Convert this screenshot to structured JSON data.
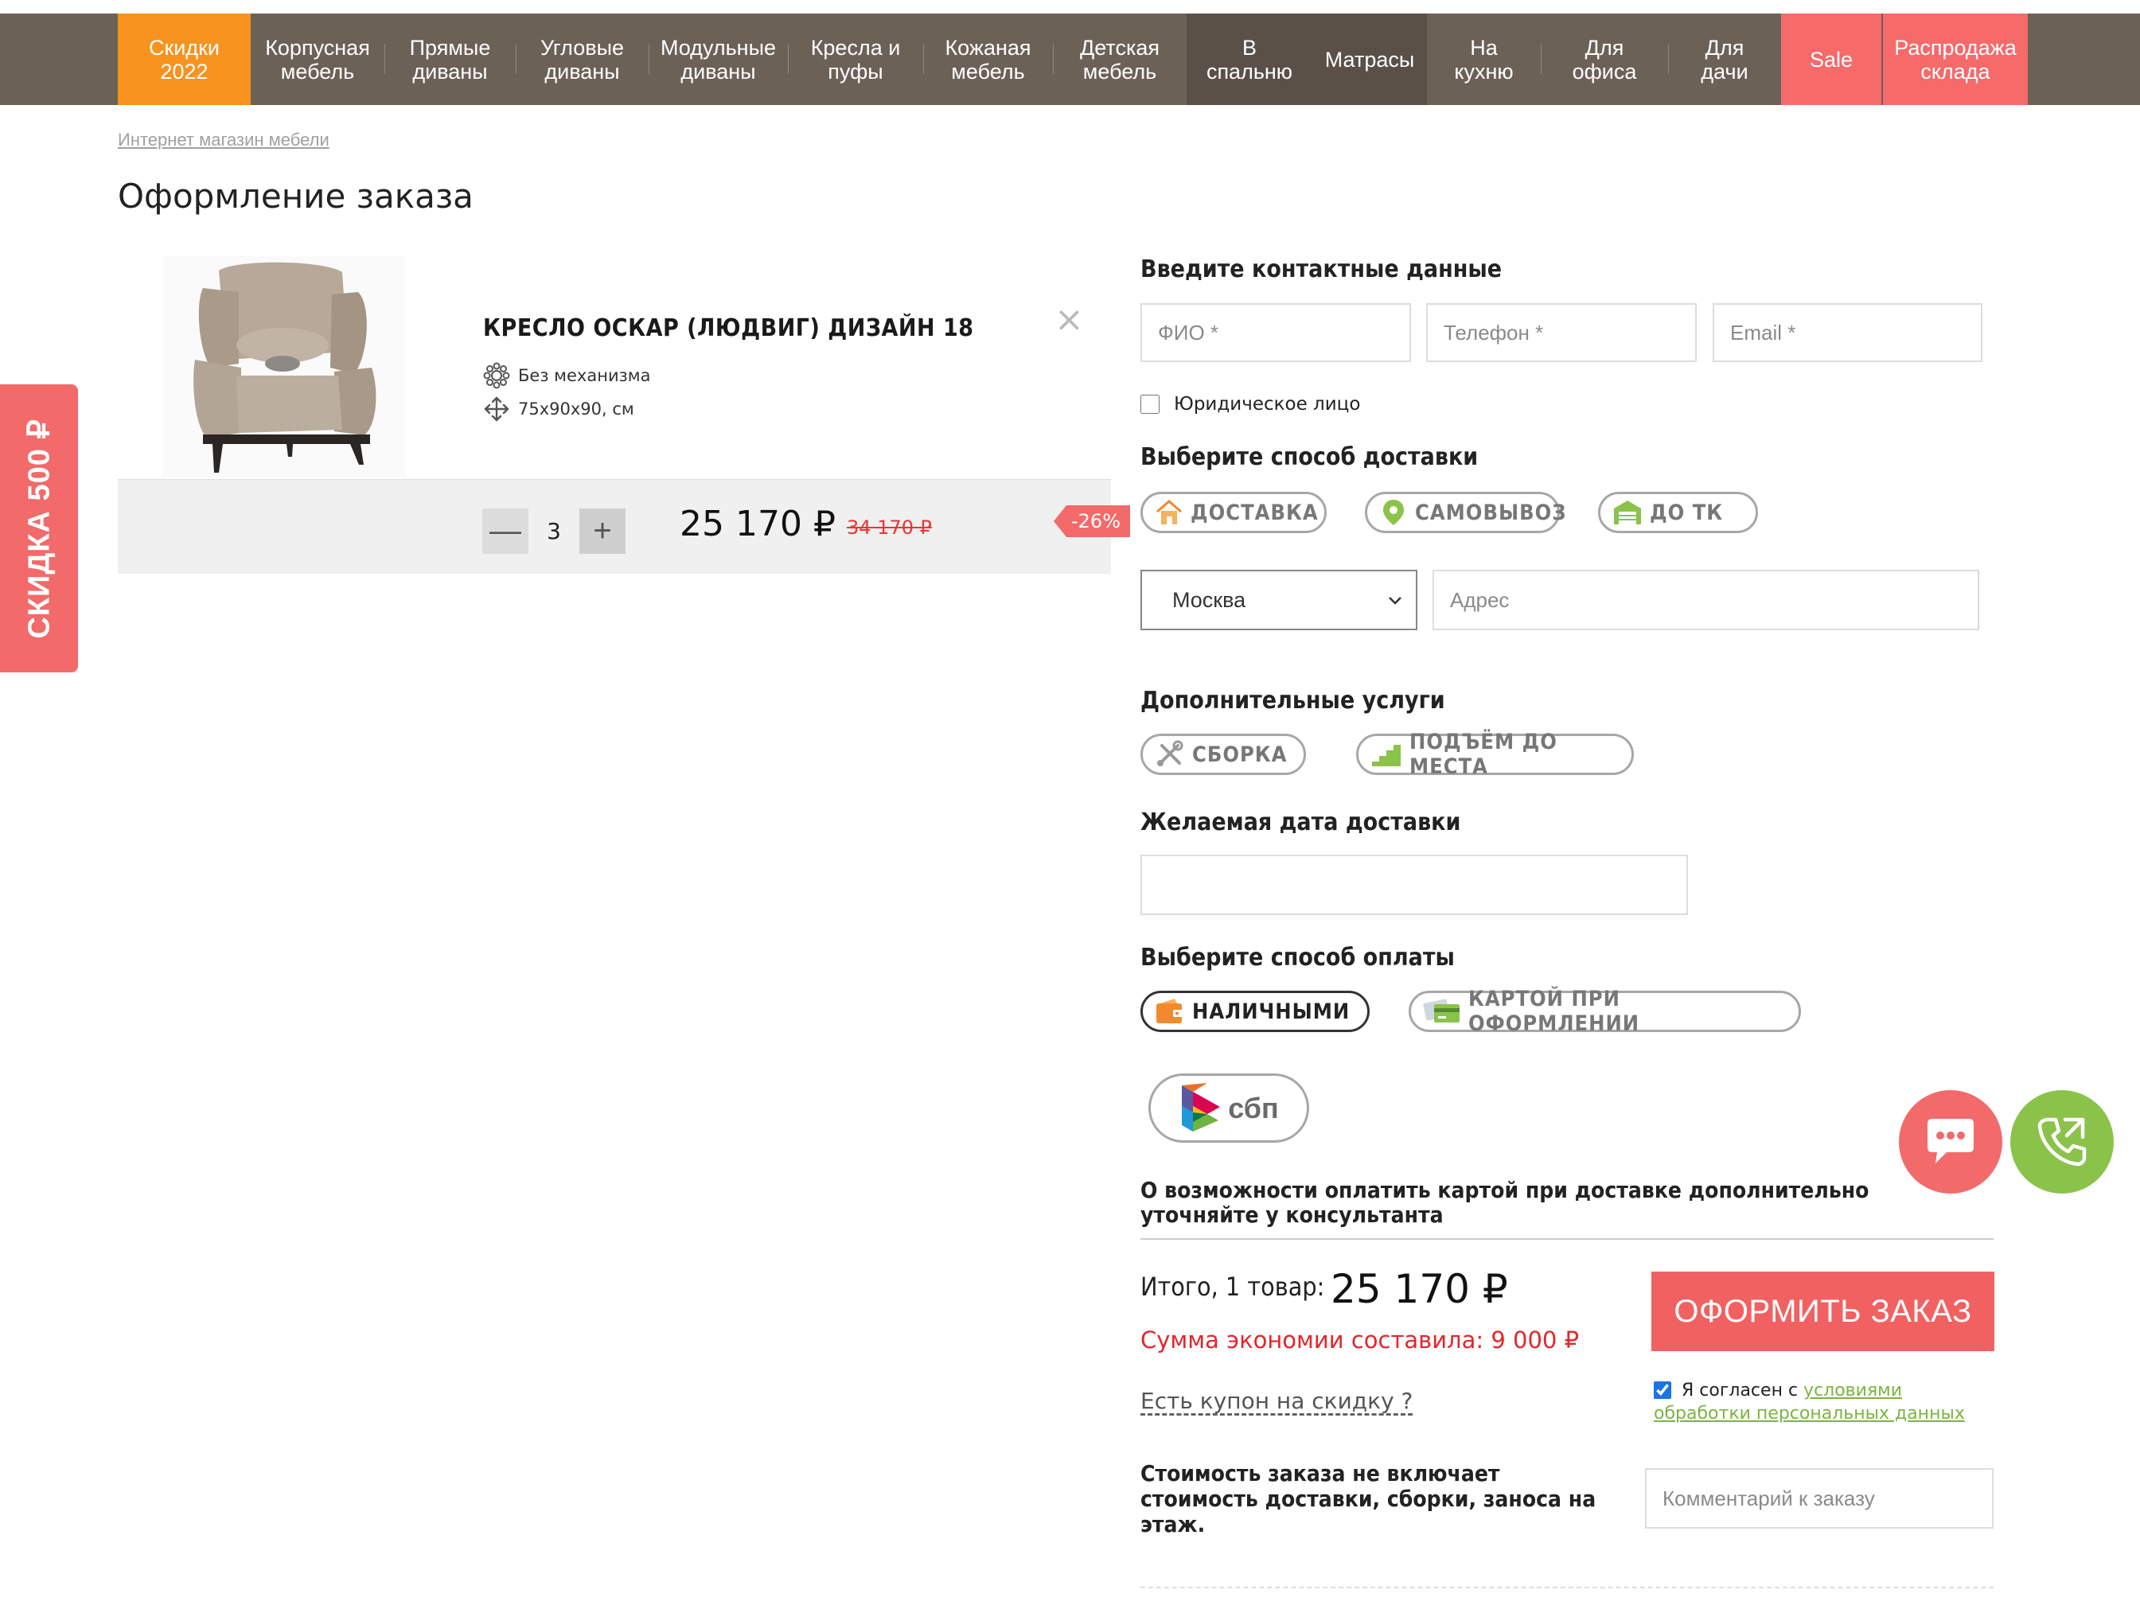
{
  "nav": [
    {
      "label": "Скидки\n2022"
    },
    {
      "label": "Корпусная\nмебель"
    },
    {
      "label": "Прямые\nдиваны"
    },
    {
      "label": "Угловые\nдиваны"
    },
    {
      "label": "Модульные\nдиваны"
    },
    {
      "label": "Кресла и\nпуфы"
    },
    {
      "label": "Кожаная\nмебель"
    },
    {
      "label": "Детская\nмебель"
    },
    {
      "label": "В\nспальню"
    },
    {
      "label": "Матрасы"
    },
    {
      "label": "На\nкухню"
    },
    {
      "label": "Для\nофиса"
    },
    {
      "label": "Для\nдачи"
    },
    {
      "label": "Sale"
    },
    {
      "label": "Распродажа\nсклада"
    }
  ],
  "side_tab": "СКИДКА 500 ₽",
  "breadcrumb": "Интернет магазин мебели",
  "page_title": "Оформление заказа",
  "cart": {
    "product_name": "КРЕСЛО ОСКАР (ЛЮДВИГ) ДИЗАЙН 18",
    "mechanism": "Без механизма",
    "size": "75х90х90, см",
    "quantity": "3",
    "price": "25 170 ₽",
    "old_price": "34 170 ₽",
    "discount": "-26%"
  },
  "contacts": {
    "title": "Введите контактные данные",
    "name_placeholder": "ФИО *",
    "phone_placeholder": "Телефон *",
    "email_placeholder": "Email *",
    "legal_entity": "Юридическое лицо"
  },
  "delivery": {
    "title": "Выберите способ доставки",
    "options": [
      "ДОСТАВКА",
      "САМОВЫВОЗ",
      "ДО ТК"
    ],
    "city": "Москва",
    "address_placeholder": "Адрес"
  },
  "services": {
    "title": "Дополнительные услуги",
    "options": [
      "СБОРКА",
      "ПОДЪЁМ ДО МЕСТА"
    ]
  },
  "date": {
    "title": "Желаемая дата доставки",
    "value": ""
  },
  "payment": {
    "title": "Выберите способ оплаты",
    "options": [
      "НАЛИЧНЫМИ",
      "КАРТОЙ ПРИ ОФОРМЛЕНИИ"
    ],
    "sbp": "сбп",
    "note": "О возможности оплатить картой при доставке дополнительно уточняйте у консультанта"
  },
  "summary": {
    "total_label": "Итого, 1 товар:",
    "total_value": "25 170 ₽",
    "savings": "Сумма экономии составила: 9 000 ₽",
    "coupon": "Есть купон на скидку ?",
    "cost_note": "Стоимость заказа не включает стоимость доставки, сборки, заноса на этаж.",
    "order_button": "ОФОРМИТЬ ЗАКАЗ",
    "agree_prefix": "Я согласен с",
    "agree_link": "условиями обработки персональных данных",
    "comment_placeholder": "Комментарий к заказу"
  },
  "colors": {
    "nav_bg": "#6c6157",
    "accent_orange": "#f7931e",
    "accent_red": "#f26161",
    "accent_green": "#8bc34a"
  }
}
